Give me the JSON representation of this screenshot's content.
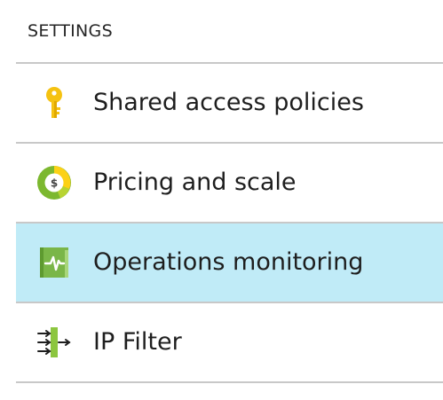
{
  "settings": {
    "header": "SETTINGS",
    "items": [
      {
        "label": "Shared access policies",
        "icon": "key-icon",
        "selected": false
      },
      {
        "label": "Pricing and scale",
        "icon": "pricing-icon",
        "selected": false
      },
      {
        "label": "Operations monitoring",
        "icon": "monitoring-icon",
        "selected": true
      },
      {
        "label": "IP Filter",
        "icon": "ip-filter-icon",
        "selected": false
      }
    ]
  },
  "colors": {
    "selected_background": "#c0ebf7",
    "divider": "#c8c8c8",
    "key": "#f5c211",
    "pricing_green": "#7cb82f",
    "pricing_yellow": "#fcd116",
    "monitoring_green": "#7ab648",
    "filter_green": "#8cc63f"
  }
}
